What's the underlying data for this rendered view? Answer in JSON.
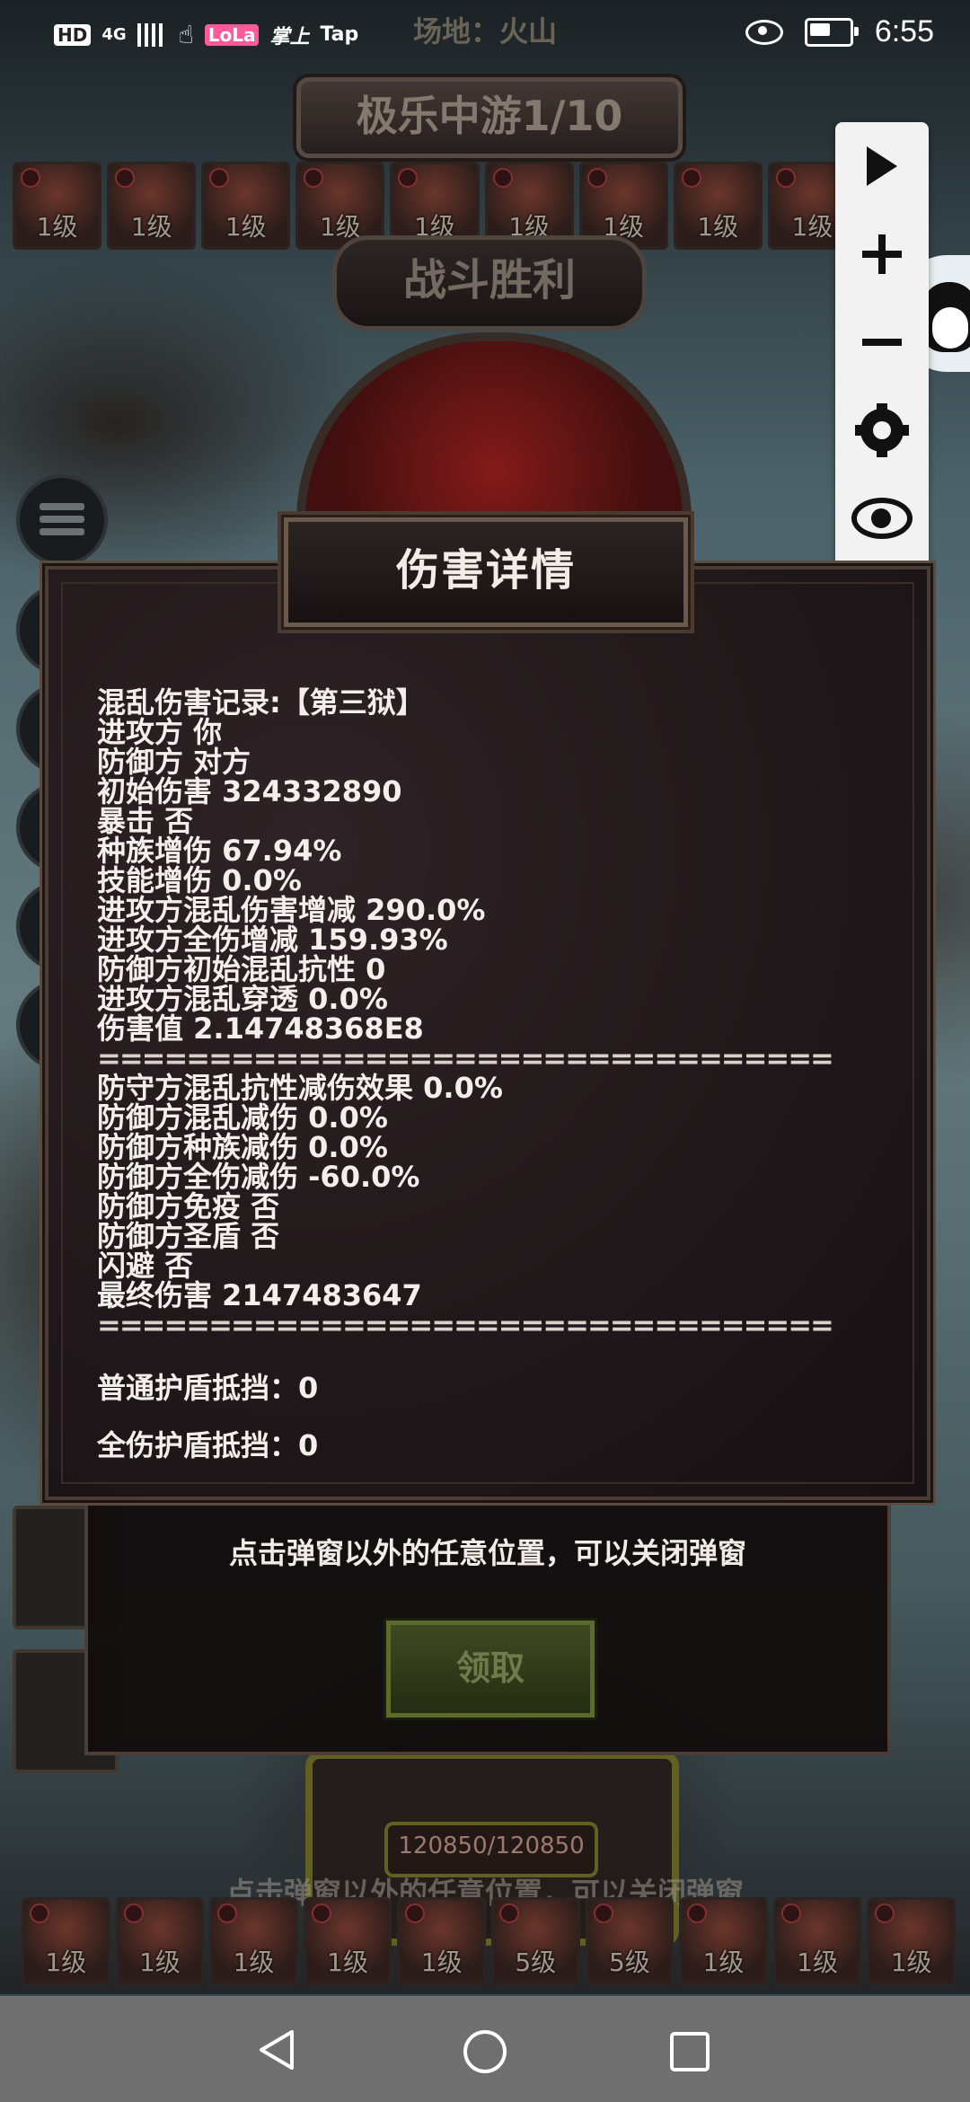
{
  "status_bar": {
    "hd": "HD",
    "net": "4G",
    "app_chip": "LoLa",
    "app_text": "掌上",
    "tap": "Tap",
    "time": "6:55"
  },
  "game": {
    "venue": "场地：火山",
    "stage": "极乐中游1/10",
    "result": "战斗胜利",
    "top_skills": [
      "1级",
      "1级",
      "1级",
      "1级",
      "1级",
      "1级",
      "1级",
      "1级",
      "1级"
    ],
    "bottom_skills": [
      "1级",
      "1级",
      "1级",
      "1级",
      "1级",
      "5级",
      "5级",
      "1级",
      "1级",
      "1级"
    ],
    "hp": "120850/120850",
    "ghost_hint": "点击弹窗以外的任意位置，可以关闭弹窗"
  },
  "dialog": {
    "title": "伤害详情",
    "lines": [
      "混乱伤害记录:【第三狱】",
      "进攻方 你",
      "防御方 对方",
      "初始伤害 324332890",
      "暴击 否",
      "种族增伤 67.94%",
      "技能增伤 0.0%",
      "进攻方混乱伤害增减 290.0%",
      "进攻方全伤增减 159.93%",
      "防御方初始混乱抗性 0",
      "进攻方混乱穿透 0.0%",
      "伤害值 2.14748368E8"
    ],
    "separator": "==============================================",
    "lines2": [
      "防守方混乱抗性减伤效果 0.0%",
      "防御方混乱减伤 0.0%",
      "防御方种族减伤 0.0%",
      "防御方全伤减伤 -60.0%",
      "防御方免疫 否",
      "防御方圣盾 否",
      "闪避 否",
      "最终伤害 2147483647"
    ],
    "normal_shield": "普通护盾抵挡：0",
    "full_shield": "全伤护盾抵挡：0"
  },
  "reward_panel": {
    "hint": "点击弹窗以外的任意位置，可以关闭弹窗",
    "claim": "领取"
  },
  "toolbar": {
    "icons": [
      "play-icon",
      "plus-icon",
      "minus-icon",
      "gear-icon",
      "eye-icon",
      "move-icon",
      "close-icon"
    ]
  }
}
